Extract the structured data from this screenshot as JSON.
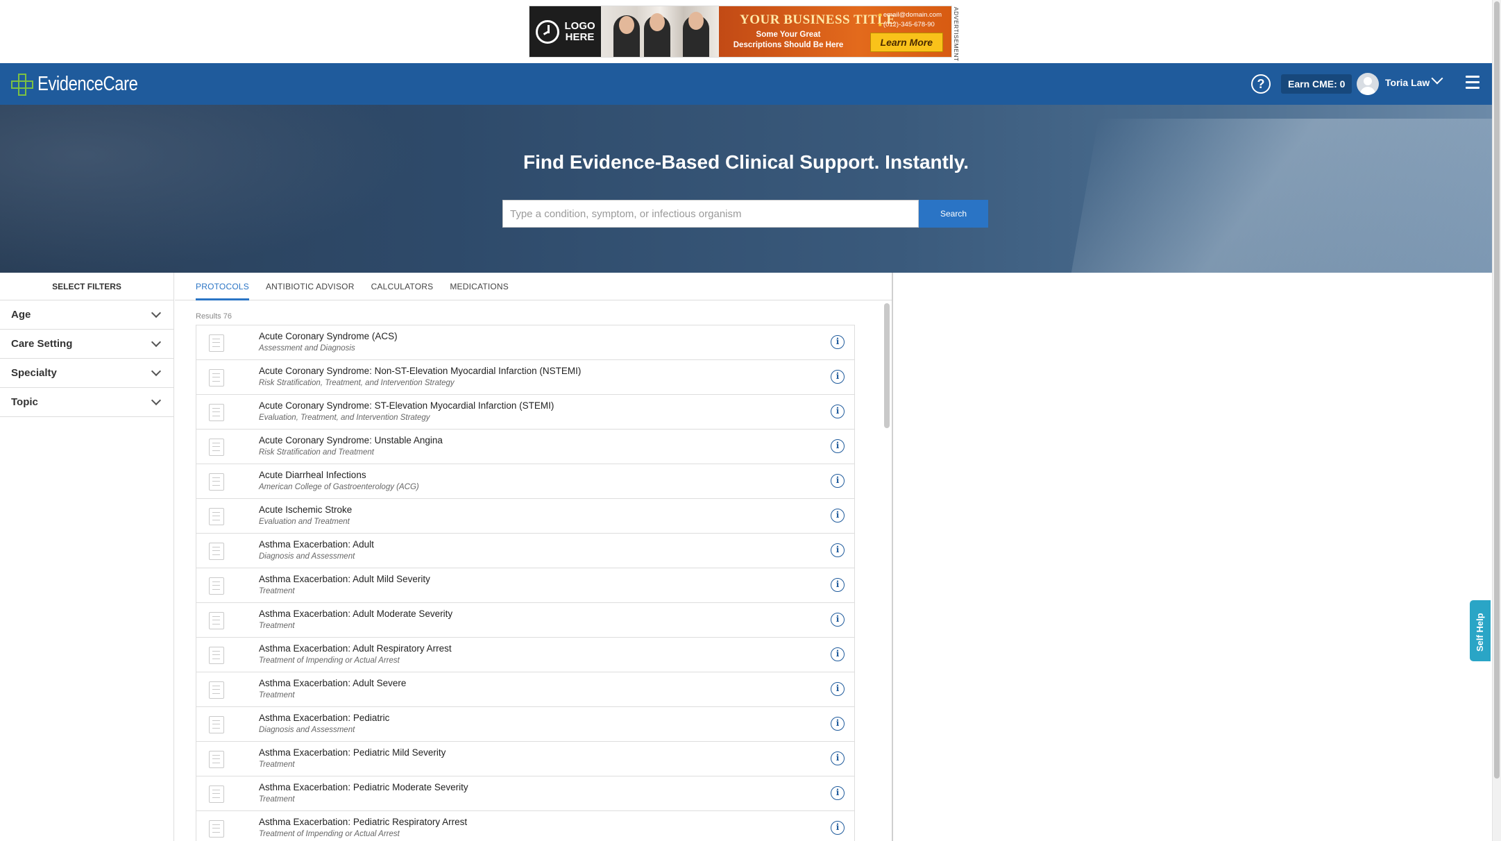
{
  "ad": {
    "logo_text": "LOGO HERE",
    "title": "YOUR BUSINESS TITLE",
    "description": "Some Your Great Descriptions Should Be Here",
    "email": "email@domain.com",
    "phone": "(012)-345-678-90",
    "cta": "Learn More",
    "label": "ADVERTISEMENT"
  },
  "nav": {
    "brand": "EvidenceCare",
    "cme_label": "Earn CME: 0",
    "user_name": "Toria Law"
  },
  "hero": {
    "title": "Find Evidence-Based Clinical Support. Instantly.",
    "search_placeholder": "Type a condition, symptom, or infectious organism",
    "search_button": "Search"
  },
  "filters": {
    "title": "SELECT FILTERS",
    "items": [
      "Age",
      "Care Setting",
      "Specialty",
      "Topic"
    ]
  },
  "tabs": [
    "PROTOCOLS",
    "ANTIBIOTIC ADVISOR",
    "CALCULATORS",
    "MEDICATIONS"
  ],
  "active_tab": "PROTOCOLS",
  "results_label": "Results 76",
  "results": [
    {
      "title": "Acute Coronary Syndrome (ACS)",
      "subtitle": "Assessment and Diagnosis"
    },
    {
      "title": "Acute Coronary Syndrome: Non-ST-Elevation Myocardial Infarction (NSTEMI)",
      "subtitle": "Risk Stratification, Treatment, and Intervention Strategy"
    },
    {
      "title": "Acute Coronary Syndrome: ST-Elevation Myocardial Infarction (STEMI)",
      "subtitle": "Evaluation, Treatment, and Intervention Strategy"
    },
    {
      "title": "Acute Coronary Syndrome: Unstable Angina",
      "subtitle": "Risk Stratification and Treatment"
    },
    {
      "title": "Acute Diarrheal Infections",
      "subtitle": "American College of Gastroenterology (ACG)"
    },
    {
      "title": "Acute Ischemic Stroke",
      "subtitle": "Evaluation and Treatment"
    },
    {
      "title": "Asthma Exacerbation: Adult",
      "subtitle": "Diagnosis and Assessment"
    },
    {
      "title": "Asthma Exacerbation: Adult Mild Severity",
      "subtitle": "Treatment"
    },
    {
      "title": "Asthma Exacerbation: Adult Moderate Severity",
      "subtitle": "Treatment"
    },
    {
      "title": "Asthma Exacerbation: Adult Respiratory Arrest",
      "subtitle": "Treatment of Impending or Actual Arrest"
    },
    {
      "title": "Asthma Exacerbation: Adult Severe",
      "subtitle": "Treatment"
    },
    {
      "title": "Asthma Exacerbation: Pediatric",
      "subtitle": "Diagnosis and Assessment"
    },
    {
      "title": "Asthma Exacerbation: Pediatric Mild Severity",
      "subtitle": "Treatment"
    },
    {
      "title": "Asthma Exacerbation: Pediatric Moderate Severity",
      "subtitle": "Treatment"
    },
    {
      "title": "Asthma Exacerbation: Pediatric Respiratory Arrest",
      "subtitle": "Treatment of Impending or Actual Arrest"
    }
  ],
  "self_help": "Self Help",
  "colors": {
    "nav_bg": "#1f5b9c",
    "accent": "#2a74c5",
    "brand_green": "#7cc142",
    "self_help": "#2aa5c6"
  }
}
